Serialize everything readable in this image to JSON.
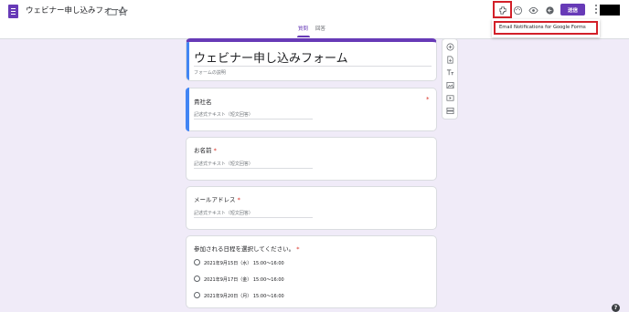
{
  "app": {
    "doc_title": "ウェビナー申し込みフォーム"
  },
  "tabs": [
    {
      "label": "質問",
      "active": true
    },
    {
      "label": "回答",
      "active": false
    }
  ],
  "toolbar": {
    "send_label": "送信",
    "addon_menu_item": "Email Notifications for Google Forms"
  },
  "form": {
    "title": "ウェビナー申し込みフォーム",
    "description_placeholder": "フォームの説明"
  },
  "questions": [
    {
      "label": "貴社名",
      "required": false,
      "answer_placeholder": "記述式テキスト（短文回答）"
    },
    {
      "label": "お名前",
      "required": true,
      "answer_placeholder": "記述式テキスト（短文回答）"
    },
    {
      "label": "メールアドレス",
      "required": true,
      "answer_placeholder": "記述式テキスト（短文回答）"
    },
    {
      "label": "参加される日程を選択してください。",
      "required": true,
      "options": [
        "2021年9月15日（水） 15:00〜16:00",
        "2021年9月17日（金） 15:00〜16:00",
        "2021年9月20日（月） 15:00〜16:00"
      ]
    }
  ],
  "required_mark": "*",
  "colors": {
    "primary": "#673ab7",
    "background": "#f0ebf8",
    "highlight": "#d32029",
    "active_bar": "#4285f4"
  },
  "icons": {
    "top": [
      "addon-icon",
      "palette-icon",
      "preview-icon",
      "undo-icon"
    ],
    "side": [
      "add-question-icon",
      "import-icon",
      "add-title-icon",
      "add-image-icon",
      "add-video-icon",
      "add-section-icon"
    ]
  },
  "help_glyph": "?"
}
